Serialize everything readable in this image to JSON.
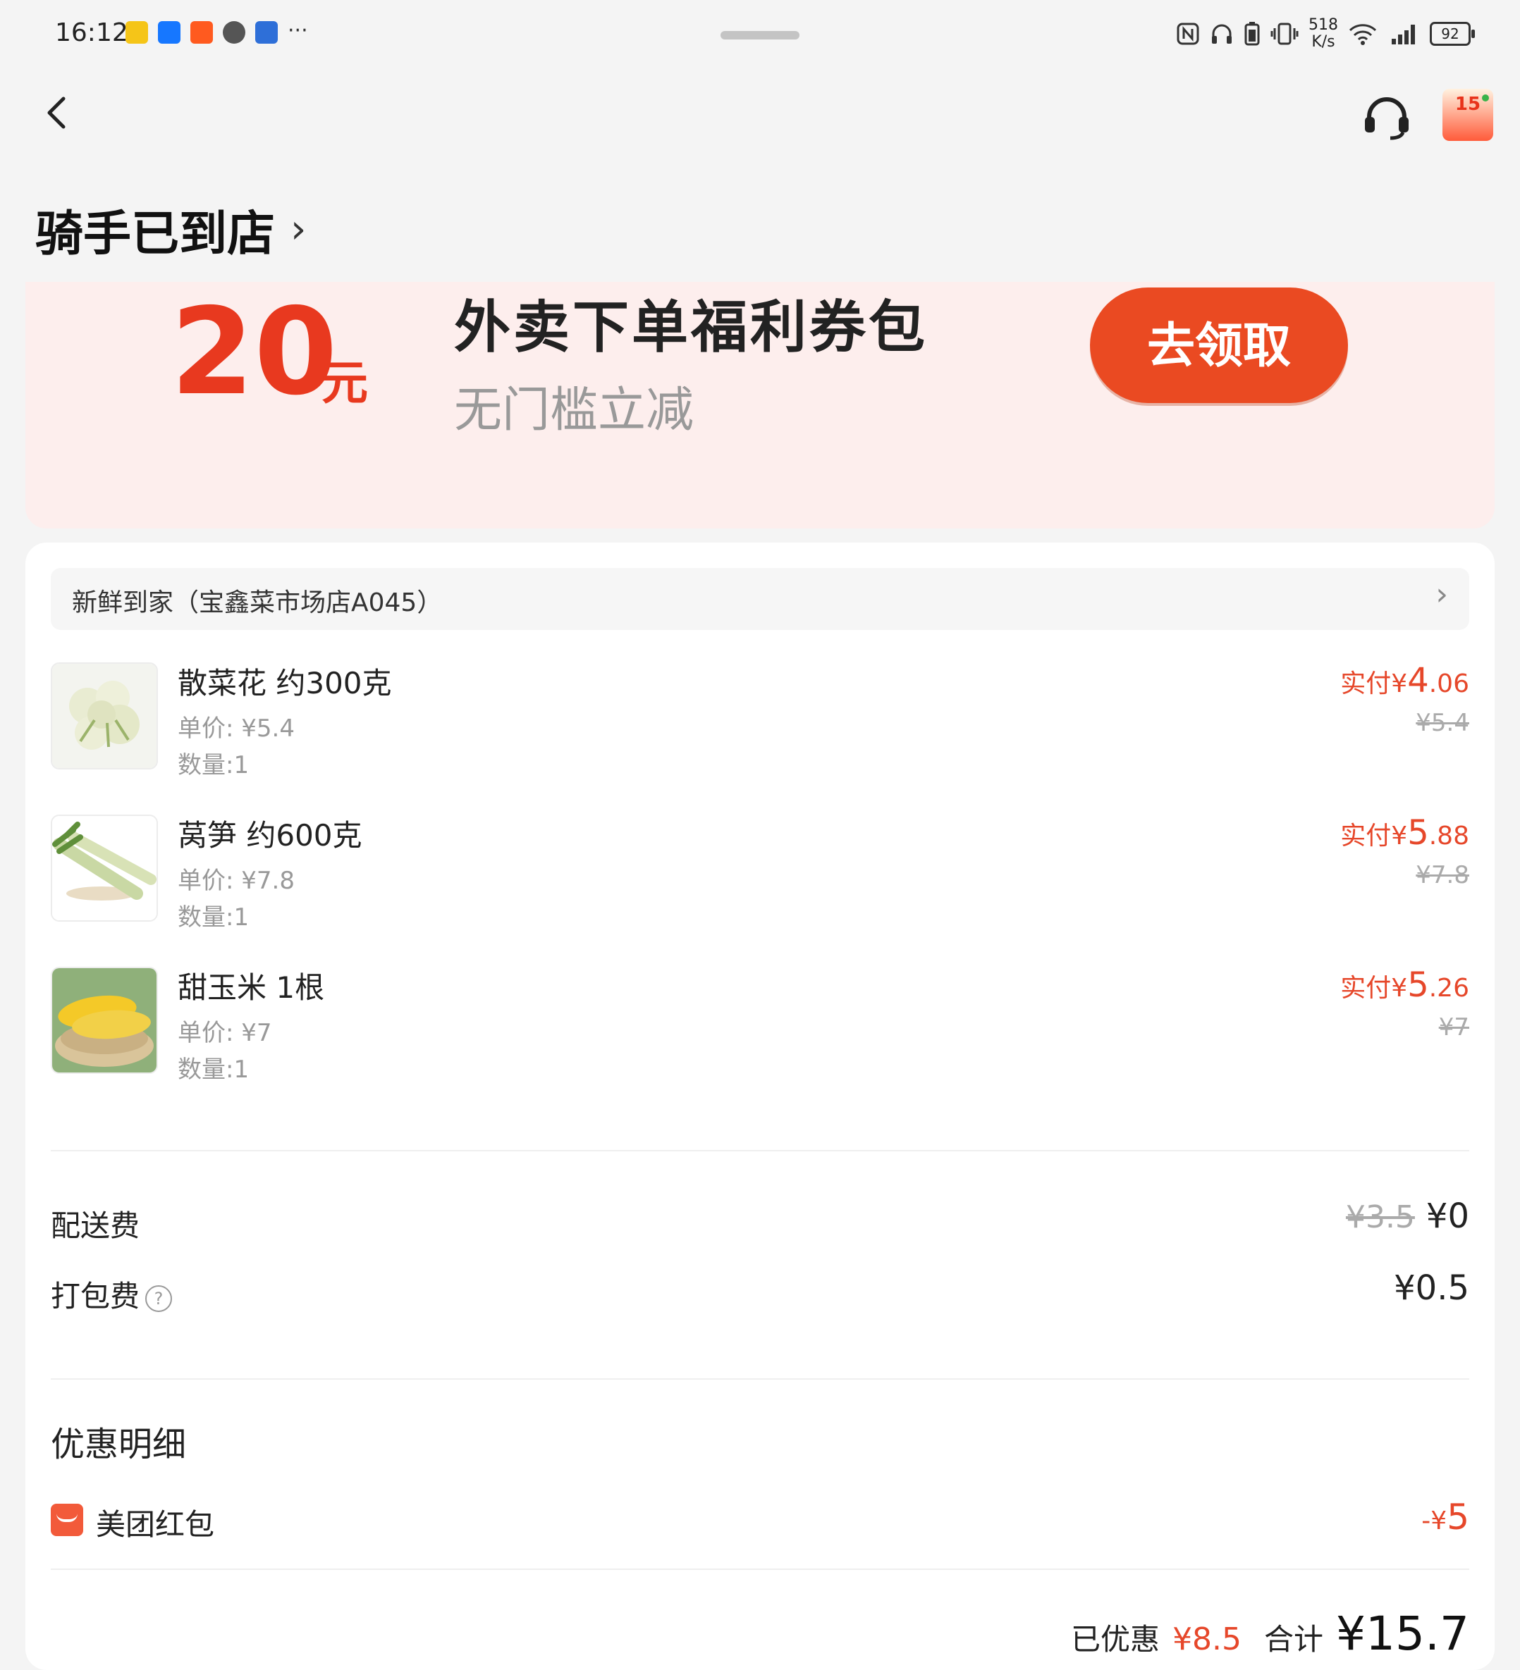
{
  "status_bar": {
    "time": "16:12",
    "network_speed_value": "518",
    "network_speed_unit": "K/s",
    "battery": "92"
  },
  "header": {
    "promo_badge": "15"
  },
  "page": {
    "title": "骑手已到店"
  },
  "coupon": {
    "amount": "20",
    "unit": "元",
    "title": "外卖下单福利券包",
    "subtitle": "无门槛立减",
    "button_label": "去领取"
  },
  "order": {
    "store_name": "新鲜到家（宝鑫菜市场店A045）",
    "items": [
      {
        "name": "散菜花 约300克",
        "unit_price": "单价: ¥5.4",
        "quantity": "数量:1",
        "pay_prefix": "实付¥",
        "pay_int": "4",
        "pay_dec": ".06",
        "original": "¥5.4"
      },
      {
        "name": "莴笋 约600克",
        "unit_price": "单价: ¥7.8",
        "quantity": "数量:1",
        "pay_prefix": "实付¥",
        "pay_int": "5",
        "pay_dec": ".88",
        "original": "¥7.8"
      },
      {
        "name": "甜玉米  1根",
        "unit_price": "单价: ¥7",
        "quantity": "数量:1",
        "pay_prefix": "实付¥",
        "pay_int": "5",
        "pay_dec": ".26",
        "original": "¥7"
      }
    ],
    "delivery_fee_label": "配送费",
    "delivery_fee_original": "¥3.5",
    "delivery_fee_value": "¥0",
    "packing_fee_label": "打包费",
    "packing_fee_value": "¥0.5",
    "discount_section_title": "优惠明细",
    "red_packet_label": "美团红包",
    "red_packet_prefix": "-¥",
    "red_packet_value": "5",
    "discounted_label": "已优惠",
    "discounted_value": "¥8.5",
    "total_label": "合计",
    "total_value": "¥15.7"
  },
  "colors": {
    "accent": "#e8391f",
    "coupon_bg": "#fdeeed",
    "page_bg": "#f4f4f4"
  }
}
